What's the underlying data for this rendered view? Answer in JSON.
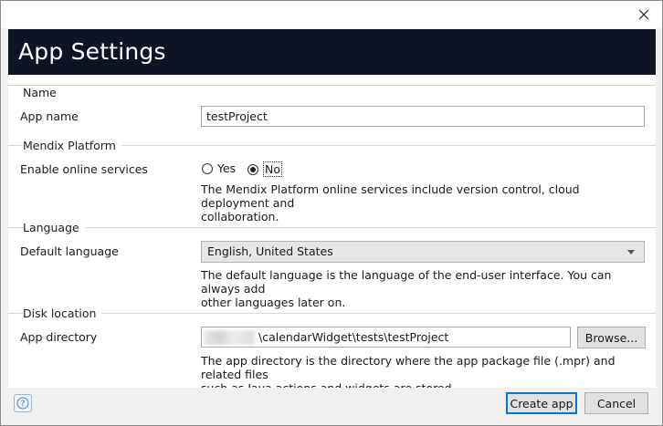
{
  "window": {
    "title": "App Settings",
    "close_icon": "close-icon"
  },
  "sections": {
    "name": {
      "title": "Name",
      "app_name_label": "App name",
      "app_name_value": "testProject"
    },
    "platform": {
      "title": "Mendix Platform",
      "online_label": "Enable online services",
      "option_yes": "Yes",
      "option_no": "No",
      "selected": "No",
      "help_line1": "The Mendix Platform online services include version control, cloud deployment and",
      "help_line2": "collaboration."
    },
    "language": {
      "title": "Language",
      "default_label": "Default language",
      "selected_value": "English, United States",
      "help_line1": "The default language is the language of the end-user interface. You can always add",
      "help_line2": "other languages later on."
    },
    "disk": {
      "title": "Disk location",
      "dir_label": "App directory",
      "dir_value_visible": "\\calendarWidget\\tests\\testProject",
      "browse_label": "Browse...",
      "help_line1": "The app directory is the directory where the app package file (.mpr) and related files",
      "help_line2": "such as Java actions and widgets are stored."
    }
  },
  "footer": {
    "help_icon": "question-icon",
    "create_label": "Create app",
    "cancel_label": "Cancel"
  },
  "colors": {
    "header_bg": "#0e1423",
    "accent": "#0078d7"
  }
}
